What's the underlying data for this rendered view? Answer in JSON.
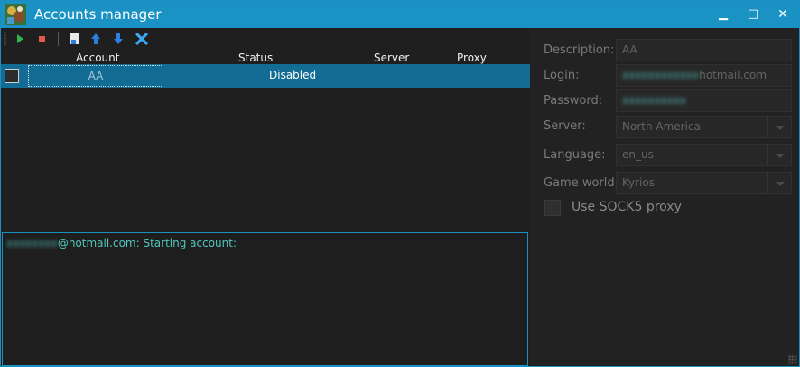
{
  "window": {
    "title": "Accounts manager"
  },
  "title_buttons": {
    "minimize": "▁",
    "maximize": "□",
    "close": "✕"
  },
  "toolbar": {
    "items": [
      "play-icon",
      "stop-icon",
      "new-account-icon",
      "arrow-up-icon",
      "arrow-down-icon",
      "delete-icon"
    ],
    "colors": {
      "play": "#2fb34a",
      "stop": "#e05a50",
      "arrows": "#2a7fe0",
      "delete": "#3aa8f0"
    }
  },
  "grid": {
    "columns": [
      "Account",
      "Status",
      "Server",
      "Proxy"
    ],
    "rows": [
      {
        "account": "AA",
        "status": "Disabled",
        "server": "",
        "proxy": ""
      }
    ]
  },
  "log": {
    "blurred_prefix": "xxxxxxxx",
    "text": "@hotmail.com: Starting account:"
  },
  "details": {
    "description_label": "Description:",
    "description_value": "AA",
    "login_label": "Login:",
    "login_blurred": "xxxxxxxxxxxx",
    "login_value": "hotmail.com",
    "password_label": "Password:",
    "password_blurred": "xxxxxxxxxx",
    "server_label": "Server:",
    "server_value": "North America",
    "language_label": "Language:",
    "language_value": "en_us",
    "gameworld_label": "Game world:",
    "gameworld_value": "Kyrios",
    "proxy_label": "Use SOCK5 proxy"
  },
  "colors": {
    "titlebar": "#1a93c4",
    "selection": "#136c94",
    "log_text": "#50c8bc"
  }
}
